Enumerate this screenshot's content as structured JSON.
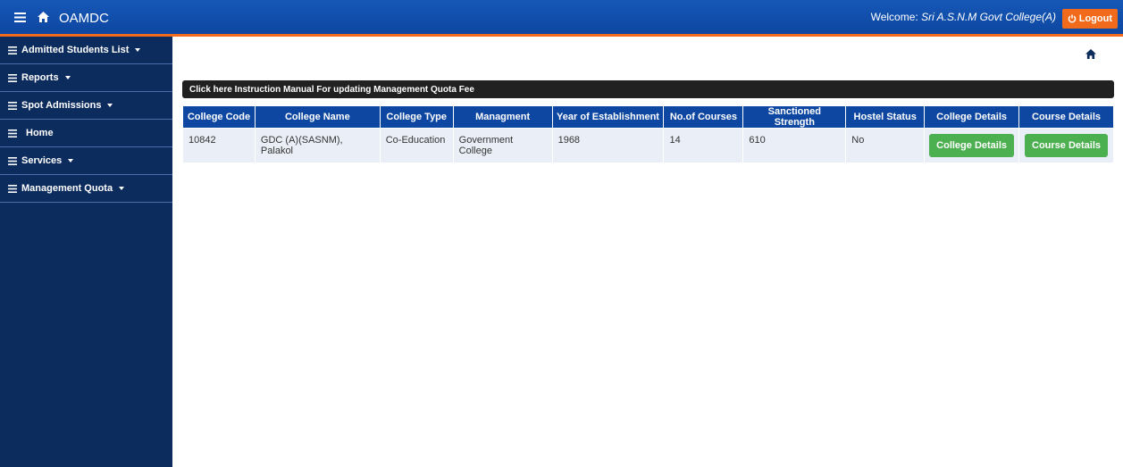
{
  "header": {
    "brand": "OAMDC",
    "welcome_label": "Welcome:",
    "welcome_user": "Sri A.S.N.M Govt College(A)",
    "logout_label": "Logout",
    "accent_color": "#f26a1b",
    "bar_color": "#0d47a1"
  },
  "sidebar": {
    "items": [
      {
        "label": "Admitted Students List",
        "dropdown": true
      },
      {
        "label": "Reports",
        "dropdown": true
      },
      {
        "label": "Spot Admissions",
        "dropdown": true
      },
      {
        "label": "Home",
        "dropdown": false
      },
      {
        "label": "Services",
        "dropdown": true
      },
      {
        "label": "Management Quota",
        "dropdown": true
      }
    ]
  },
  "main": {
    "banner_text": "Click here Instruction Manual For updating Management Quota Fee",
    "table": {
      "headers": [
        "College Code",
        "College Name",
        "College Type",
        "Managment",
        "Year of Establishment",
        "No.of Courses",
        "Sanctioned Strength",
        "Hostel Status",
        "College Details",
        "Course Details"
      ],
      "rows": [
        {
          "college_code": "10842",
          "college_name": "GDC (A)(SASNM), Palakol",
          "college_type": "Co-Education",
          "management": "Government College",
          "year": "1968",
          "courses": "14",
          "strength": "610",
          "hostel": "No",
          "college_details_btn": "College Details",
          "course_details_btn": "Course Details"
        }
      ]
    }
  }
}
